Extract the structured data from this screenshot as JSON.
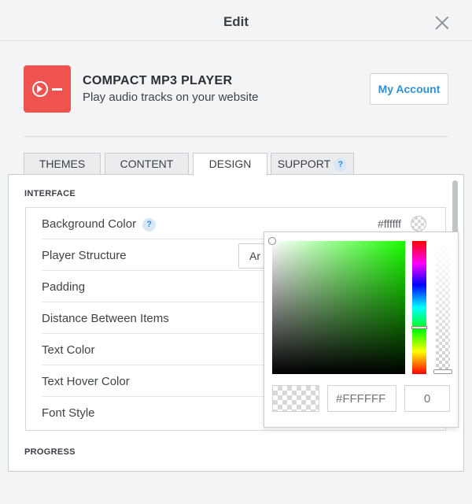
{
  "modal": {
    "title": "Edit"
  },
  "app": {
    "name": "COMPACT MP3 PLAYER",
    "description": "Play audio tracks on your website",
    "account_button": "My Account",
    "accent_color": "#ef5350"
  },
  "tabs": [
    {
      "label": "THEMES",
      "active": false
    },
    {
      "label": "CONTENT",
      "active": false
    },
    {
      "label": "DESIGN",
      "active": true
    },
    {
      "label": "SUPPORT",
      "active": false,
      "help_badge": "?"
    }
  ],
  "sections": {
    "interface": "INTERFACE",
    "progress": "PROGRESS"
  },
  "settings": [
    {
      "label": "Background Color",
      "help_badge": "?",
      "value": "#ffffff"
    },
    {
      "label": "Player Structure",
      "value": "Ar"
    },
    {
      "label": "Padding"
    },
    {
      "label": "Distance Between Items"
    },
    {
      "label": "Text Color"
    },
    {
      "label": "Text Hover Color"
    },
    {
      "label": "Font Style"
    }
  ],
  "color_picker": {
    "hex_placeholder": "#FFFFFF",
    "alpha_placeholder": "0",
    "hue_color": "#1aff00",
    "hue_level": 0.65,
    "alpha_level": 1.0
  }
}
